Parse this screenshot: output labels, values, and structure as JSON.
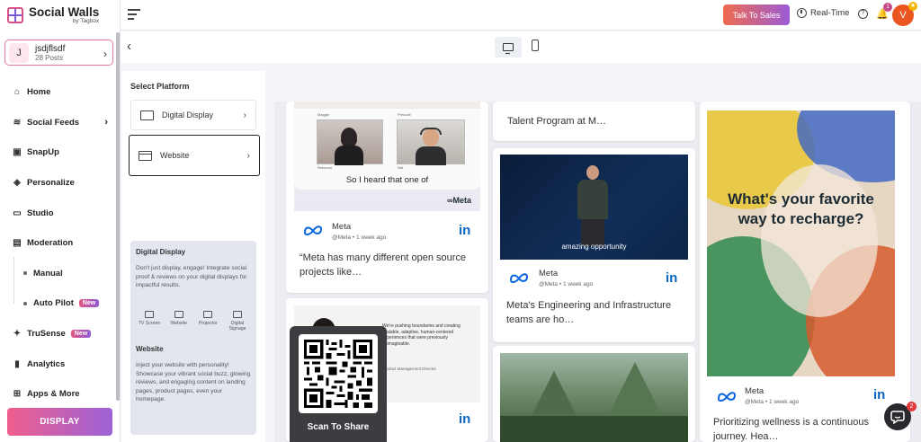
{
  "brand": {
    "name": "Social Walls",
    "sub": "by Tagbox"
  },
  "account": {
    "initial": "J",
    "name": "jsdjflsdf",
    "posts": "28 Posts"
  },
  "nav": {
    "home": "Home",
    "social_feeds": "Social Feeds",
    "snapup": "SnapUp",
    "personalize": "Personalize",
    "studio": "Studio",
    "moderation": "Moderation",
    "manual": "Manual",
    "auto_pilot": "Auto Pilot",
    "trusense": "TruSense",
    "analytics": "Analytics",
    "apps_more": "Apps & More",
    "new_badge": "New"
  },
  "display_button": "DISPLAY",
  "topbar": {
    "talk_to_sales": "Talk To Sales",
    "realtime": "Real-Time",
    "notification_count": "1",
    "user_initial": "V"
  },
  "platform": {
    "title": "Select Platform",
    "options": [
      "Digital Display",
      "Website"
    ],
    "info": {
      "display_heading": "Digital Display",
      "display_text": "Don't just display, engage! Integrate social proof & reviews on your digital displays for impactful results.",
      "icons": [
        "TV Screen",
        "Website",
        "Projector",
        "Digital Signage"
      ],
      "website_heading": "Website",
      "website_text": "Inject your website with personality! Showcase your vibrant social buzz, glowing reviews, and engaging content on landing pages, product pages, even your homepage."
    }
  },
  "feed": {
    "card1": {
      "caption": "So I heard that one of",
      "brand": "Meta",
      "tile_names": [
        "Maggie",
        "Prescott",
        "Rebecca",
        "Nat"
      ],
      "author": "Meta",
      "handle": "@Meta",
      "time": "1 week ago",
      "text": "“Meta has many different open source projects like…"
    },
    "card2": {
      "quote": "We're pushing boundaries and creating scalable, adaptive, human-centered experiences that were previously unimaginable.",
      "attribution": "Product Management Director"
    },
    "card3": {
      "text": "Talent Program at M…"
    },
    "card4": {
      "video_caption": "amazing opportunity",
      "author": "Meta",
      "handle": "@Meta",
      "time": "1 week ago",
      "text": "Meta's Engineering and Infrastructure teams are ho…"
    },
    "card6": {
      "headline": "What's your favorite way to recharge?",
      "author": "Meta",
      "handle": "@Meta",
      "time": "1 week ago",
      "text": "Prioritizing wellness is a continuous journey. Hea…"
    }
  },
  "qr": {
    "label": "Scan To Share"
  },
  "chat": {
    "badge": "2"
  }
}
